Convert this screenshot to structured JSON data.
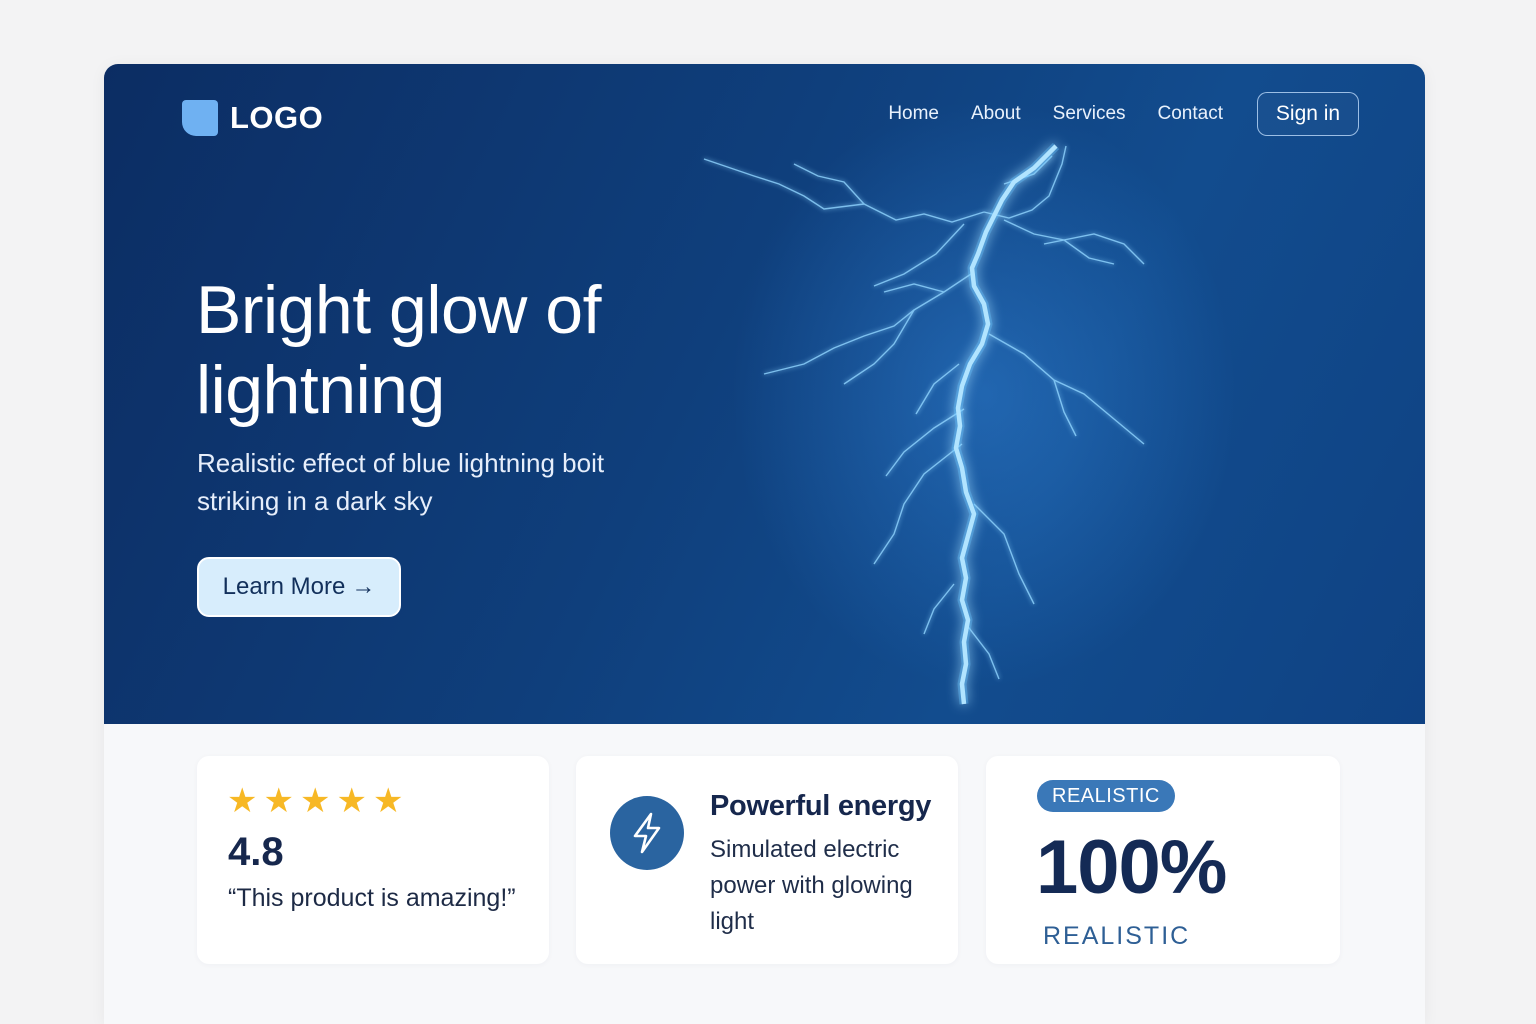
{
  "logo": {
    "text": "LOGO"
  },
  "nav": {
    "items": [
      "Home",
      "About",
      "Services",
      "Contact"
    ],
    "signin_label": "Sign in"
  },
  "hero": {
    "headline": "Bright glow of lightning",
    "subheadline": "Realistic effect of blue lightning boit striking in a dark sky",
    "cta_label": "Learn More",
    "cta_arrow": "→"
  },
  "cards": {
    "rating": {
      "stars": 5,
      "star_glyph": "★",
      "value": "4.8",
      "quote": "“This product is amazing!”"
    },
    "energy": {
      "icon": "lightning-bolt-icon",
      "title": "Powerful energy",
      "description": "Simulated electric power with glowing light"
    },
    "realistic": {
      "badge": "REALISTIC",
      "value": "100%",
      "label": "REALISTIC"
    }
  },
  "colors": {
    "hero_dark": "#0c2d63",
    "hero_mid": "#124c8e",
    "accent": "#3a78b8",
    "star": "#f7b825",
    "cta_bg": "#d7edfc",
    "text_dark": "#16274d"
  }
}
